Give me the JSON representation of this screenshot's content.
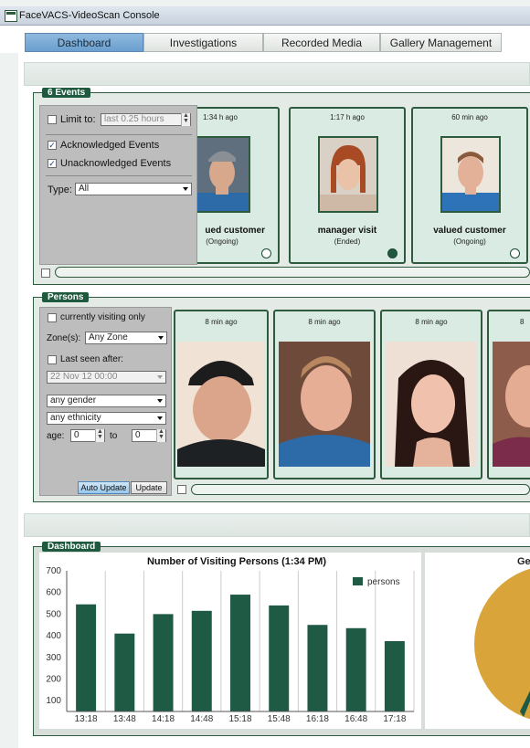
{
  "window": {
    "title": "FaceVACS-VideoScan Console"
  },
  "tabs": [
    {
      "label": "Dashboard",
      "active": true
    },
    {
      "label": "Investigations",
      "active": false
    },
    {
      "label": "Recorded Media",
      "active": false
    },
    {
      "label": "Gallery Management",
      "active": false
    }
  ],
  "events": {
    "title": "6 Events",
    "filter": {
      "limit_label": "Limit to:",
      "limit_checked": false,
      "limit_value": "last 0.25 hours",
      "acknowledged_label": "Acknowledged Events",
      "acknowledged_checked": true,
      "unacknowledged_label": "Unacknowledged Events",
      "unacknowledged_checked": true,
      "type_label": "Type:",
      "type_value": "All"
    },
    "cards": [
      {
        "time": "1:34 h ago",
        "name": "ued customer",
        "status": "(Ongoing)",
        "acknowledged": false
      },
      {
        "time": "1:17 h ago",
        "name": "manager visit",
        "status": "(Ended)",
        "acknowledged": true
      },
      {
        "time": "60 min ago",
        "name": "valued customer",
        "status": "(Ongoing)",
        "acknowledged": false
      }
    ]
  },
  "persons": {
    "title": "Persons",
    "filter": {
      "visiting_label": "currently visiting only",
      "visiting_checked": false,
      "zones_label": "Zone(s):",
      "zones_value": "Any Zone",
      "last_seen_label": "Last seen after:",
      "last_seen_checked": false,
      "last_seen_value": "22 Nov 12 00:00",
      "gender_value": "any gender",
      "ethnicity_value": "any ethnicity",
      "age_label": "age:",
      "age_from": "0",
      "age_to_label": "to",
      "age_to": "0",
      "auto_update_label": "Auto Update",
      "update_label": "Update"
    },
    "cards": [
      {
        "time": "8 min ago"
      },
      {
        "time": "8 min ago"
      },
      {
        "time": "8 min ago"
      },
      {
        "time": "8"
      }
    ]
  },
  "dashboard": {
    "title": "Dashboard",
    "pie_title_partial": "Ge",
    "colors": {
      "bar": "#1f5a45",
      "pie_main": "#d9a43a",
      "pie_slice": "#1f5a45"
    }
  },
  "chart_data": {
    "type": "bar",
    "title": "Number of Visiting Persons (1:34 PM)",
    "categories": [
      "13:18",
      "13:48",
      "14:18",
      "14:48",
      "15:18",
      "15:48",
      "16:18",
      "16:48",
      "17:18"
    ],
    "series": [
      {
        "name": "persons",
        "values": [
          545,
          410,
          500,
          515,
          590,
          540,
          450,
          435,
          375
        ]
      }
    ],
    "ylim": [
      50,
      700
    ],
    "yticks": [
      100,
      200,
      300,
      400,
      500,
      600,
      700
    ],
    "legend": "top-right",
    "grid": "vertical"
  }
}
